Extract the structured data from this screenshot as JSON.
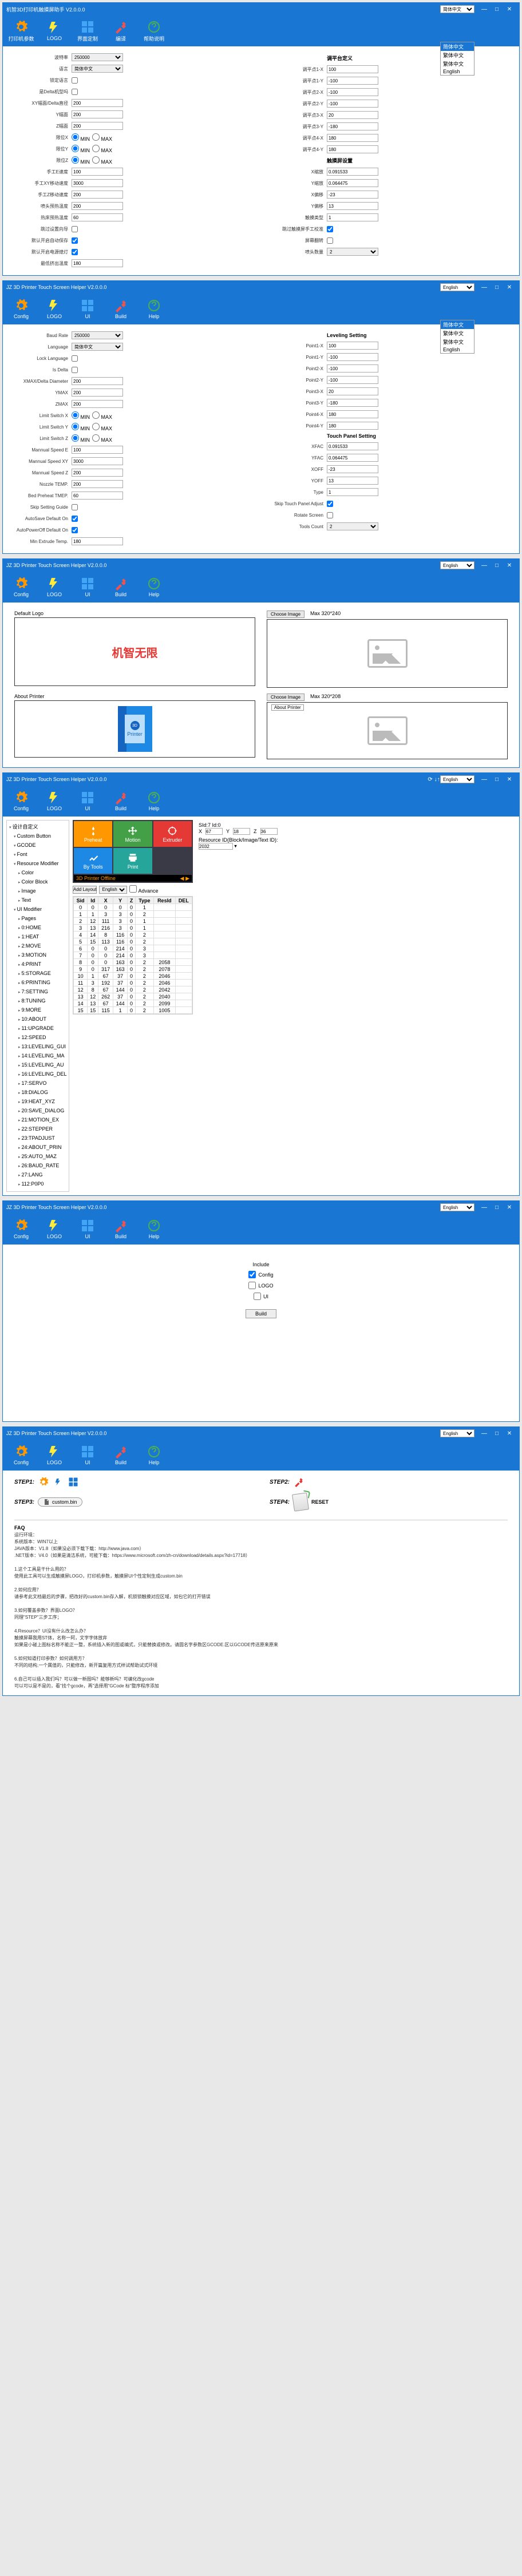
{
  "app": {
    "title_cn": "机智3D打印机触摸屏助手 V2.0.0.0",
    "title_en": "JZ 3D Printer Touch Screen Helper V2.0.0.0"
  },
  "lang": {
    "options": [
      "简体中文",
      "繁体中文",
      "繁体中文",
      "English"
    ],
    "sel_cn": "简体中文",
    "sel_en": "English"
  },
  "toolbar_cn": {
    "config": "打印机参数",
    "logo": "LOGO",
    "ui": "界面定制",
    "build": "编译",
    "help": "帮助说明"
  },
  "toolbar_en": {
    "config": "Config",
    "logo": "LOGO",
    "ui": "UI",
    "build": "Build",
    "help": "Help"
  },
  "cfg_cn": {
    "left": [
      {
        "lbl": "波特率",
        "type": "select",
        "val": "250000"
      },
      {
        "lbl": "语言",
        "type": "select",
        "val": "简体中文"
      },
      {
        "lbl": "锁定语言",
        "type": "check",
        "val": false
      },
      {
        "lbl": "是Delta机型吗",
        "type": "check",
        "val": false
      },
      {
        "lbl": "XY幅面/Delta直径",
        "type": "text",
        "val": "200"
      },
      {
        "lbl": "Y幅面",
        "type": "text",
        "val": "200"
      },
      {
        "lbl": "Z幅面",
        "type": "text",
        "val": "200"
      },
      {
        "lbl": "限位X",
        "type": "radio",
        "opts": [
          "MIN",
          "MAX"
        ],
        "val": "MIN"
      },
      {
        "lbl": "限位Y",
        "type": "radio",
        "opts": [
          "MIN",
          "MAX"
        ],
        "val": "MIN"
      },
      {
        "lbl": "限位Z",
        "type": "radio",
        "opts": [
          "MIN",
          "MAX"
        ],
        "val": "MIN"
      },
      {
        "lbl": "手工E速度",
        "type": "text",
        "val": "100"
      },
      {
        "lbl": "手工XY移动速度",
        "type": "text",
        "val": "3000"
      },
      {
        "lbl": "手工Z移动速度",
        "type": "text",
        "val": "200"
      },
      {
        "lbl": "喷头预热温度",
        "type": "text",
        "val": "200"
      },
      {
        "lbl": "热床预热温度",
        "type": "text",
        "val": "60"
      },
      {
        "lbl": "跳过设置向导",
        "type": "check",
        "val": false
      },
      {
        "lbl": "默认开启自动保存",
        "type": "check",
        "val": true
      },
      {
        "lbl": "默认开启电源熄灯",
        "type": "check",
        "val": true
      },
      {
        "lbl": "最低挤出温度",
        "type": "text",
        "val": "180"
      }
    ],
    "right_title": "调平台定义",
    "right": [
      {
        "lbl": "调平点1-X",
        "type": "text",
        "val": "100"
      },
      {
        "lbl": "调平点1-Y",
        "type": "text",
        "val": "-100"
      },
      {
        "lbl": "调平点2-X",
        "type": "text",
        "val": "-100"
      },
      {
        "lbl": "调平点2-Y",
        "type": "text",
        "val": "-100"
      },
      {
        "lbl": "调平点3-X",
        "type": "text",
        "val": "20"
      },
      {
        "lbl": "调平点3-Y",
        "type": "text",
        "val": "-180"
      },
      {
        "lbl": "调平点4-X",
        "type": "text",
        "val": "180"
      },
      {
        "lbl": "调平点4-Y",
        "type": "text",
        "val": "180"
      }
    ],
    "right2_title": "触摸屏设置",
    "right2": [
      {
        "lbl": "X缩放",
        "type": "text",
        "val": "0.091533"
      },
      {
        "lbl": "Y缩放",
        "type": "text",
        "val": "0.064475"
      },
      {
        "lbl": "X偏移",
        "type": "text",
        "val": "-23"
      },
      {
        "lbl": "Y偏移",
        "type": "text",
        "val": "13"
      },
      {
        "lbl": "触摸类型",
        "type": "text",
        "val": "1"
      },
      {
        "lbl": "跳过触摸屏手工校准",
        "type": "check",
        "val": true
      },
      {
        "lbl": "屏幕翻转",
        "type": "check",
        "val": false
      },
      {
        "lbl": "喷头数量",
        "type": "select",
        "val": "2"
      }
    ]
  },
  "cfg_en": {
    "left": [
      {
        "lbl": "Baud Rate",
        "type": "select",
        "val": "250000"
      },
      {
        "lbl": "Language",
        "type": "select",
        "val": "简体中文"
      },
      {
        "lbl": "Lock Language",
        "type": "check",
        "val": false
      },
      {
        "lbl": "Is Delta",
        "type": "check",
        "val": false
      },
      {
        "lbl": "XMAX/Delta Diameter",
        "type": "text",
        "val": "200"
      },
      {
        "lbl": "YMAX",
        "type": "text",
        "val": "200"
      },
      {
        "lbl": "ZMAX",
        "type": "text",
        "val": "200"
      },
      {
        "lbl": "Limit Switch X",
        "type": "radio",
        "opts": [
          "MIN",
          "MAX"
        ],
        "val": "MIN"
      },
      {
        "lbl": "Limit Switch Y",
        "type": "radio",
        "opts": [
          "MIN",
          "MAX"
        ],
        "val": "MIN"
      },
      {
        "lbl": "Limit Switch Z",
        "type": "radio",
        "opts": [
          "MIN",
          "MAX"
        ],
        "val": "MIN"
      },
      {
        "lbl": "Mannual Speed E",
        "type": "text",
        "val": "100"
      },
      {
        "lbl": "Mannual Speed XY",
        "type": "text",
        "val": "3000"
      },
      {
        "lbl": "Mannual Speed Z",
        "type": "text",
        "val": "200"
      },
      {
        "lbl": "Nozzle TEMP.",
        "type": "text",
        "val": "200"
      },
      {
        "lbl": "Bed Preheat TMEP.",
        "type": "text",
        "val": "60"
      },
      {
        "lbl": "Skip Setting Guide",
        "type": "check",
        "val": false
      },
      {
        "lbl": "AutoSave Default On",
        "type": "check",
        "val": true
      },
      {
        "lbl": "AutoPowerOff Default On",
        "type": "check",
        "val": true
      },
      {
        "lbl": "Min Extrude Temp.",
        "type": "text",
        "val": "180"
      }
    ],
    "right_title": "Leveling Setting",
    "right": [
      {
        "lbl": "Point1-X",
        "type": "text",
        "val": "100"
      },
      {
        "lbl": "Point1-Y",
        "type": "text",
        "val": "-100"
      },
      {
        "lbl": "Point2-X",
        "type": "text",
        "val": "-100"
      },
      {
        "lbl": "Point2-Y",
        "type": "text",
        "val": "-100"
      },
      {
        "lbl": "Point3-X",
        "type": "text",
        "val": "20"
      },
      {
        "lbl": "Point3-Y",
        "type": "text",
        "val": "-180"
      },
      {
        "lbl": "Point4-X",
        "type": "text",
        "val": "180"
      },
      {
        "lbl": "Point4-Y",
        "type": "text",
        "val": "180"
      }
    ],
    "right2_title": "Touch Panel Setting",
    "right2": [
      {
        "lbl": "XFAC",
        "type": "text",
        "val": "0.091533"
      },
      {
        "lbl": "YFAC",
        "type": "text",
        "val": "0.064475"
      },
      {
        "lbl": "XOFF",
        "type": "text",
        "val": "-23"
      },
      {
        "lbl": "YOFF",
        "type": "text",
        "val": "13"
      },
      {
        "lbl": "Type",
        "type": "text",
        "val": "1"
      },
      {
        "lbl": "Skip Touch Panel Adjust",
        "type": "check",
        "val": true
      },
      {
        "lbl": "Rotate Screen",
        "type": "check",
        "val": false
      },
      {
        "lbl": "Tools Count",
        "type": "select",
        "val": "2"
      }
    ]
  },
  "logo": {
    "default_label": "Default Logo",
    "choose": "Choose Image",
    "sz1": "Max 320*240",
    "sz2": "Max 320*208",
    "about": "About Printer",
    "about2": "About Printer",
    "jizhi": "机智无限",
    "printer": "3D",
    "printer2": "Printer"
  },
  "ui": {
    "tree": [
      "设计自定义",
      "Custom Button",
      "GCODE",
      "Font",
      "Resource Modifier",
      "Color",
      "Color Block",
      "Image",
      "Text",
      "UI Modifier",
      "Pages",
      "0:HOME",
      "1:HEAT",
      "2:MOVE",
      "3:MOTION",
      "4:PRINT",
      "5:STORAGE",
      "6:PRINTING",
      "7:SETTING",
      "8:TUNING",
      "9:MORE",
      "10:ABOUT",
      "11:UPGRADE",
      "12:SPEED",
      "13:LEVELING_GUI",
      "14:LEVELING_MA",
      "15:LEVELING_AU",
      "16:LEVELING_DEL",
      "17:SERVO",
      "18:DIALOG",
      "19:HEAT_XYZ",
      "20:SAVE_DIALOG",
      "21:MOTION_EX",
      "22:STEPPER",
      "23:TPADJUST",
      "24:ABOUT_PRIN",
      "25:AUTO_MAZ",
      "26:BAUD_RATE",
      "27:LANG",
      "112:P0P0"
    ],
    "preview": {
      "t1": {
        "label": "Preheat",
        "color": "#ff9800"
      },
      "t2": {
        "label": "Motion",
        "color": "#43a047"
      },
      "t3": {
        "label": "Extruder",
        "color": "#e53935"
      },
      "t4": {
        "label": "By Tools",
        "color": "#1e88e5"
      },
      "t5": {
        "label": "Print",
        "color": "#26a69a"
      },
      "strip": "3D Printer Offline"
    },
    "ctl": {
      "add": "Add Layout",
      "lang": "English",
      "adv": "Advance"
    },
    "cols": [
      "Sid",
      "Id",
      "X",
      "Y",
      "Z",
      "Type",
      "ResId",
      "DEL"
    ],
    "rows": [
      [
        "0",
        "0",
        "0",
        "0",
        "0",
        "1",
        "",
        ""
      ],
      [
        "1",
        "1",
        "3",
        "3",
        "0",
        "2",
        "",
        ""
      ],
      [
        "2",
        "12",
        "111",
        "3",
        "0",
        "1",
        "",
        ""
      ],
      [
        "3",
        "13",
        "216",
        "3",
        "0",
        "1",
        "",
        ""
      ],
      [
        "4",
        "14",
        "8",
        "116",
        "0",
        "2",
        "",
        ""
      ],
      [
        "5",
        "15",
        "113",
        "116",
        "0",
        "2",
        "",
        ""
      ],
      [
        "6",
        "0",
        "0",
        "214",
        "0",
        "3",
        "",
        ""
      ],
      [
        "7",
        "0",
        "0",
        "214",
        "0",
        "3",
        "",
        ""
      ],
      [
        "8",
        "0",
        "0",
        "163",
        "0",
        "2",
        "2058",
        ""
      ],
      [
        "9",
        "0",
        "317",
        "163",
        "0",
        "2",
        "2078",
        ""
      ],
      [
        "10",
        "1",
        "67",
        "37",
        "0",
        "2",
        "2046",
        ""
      ],
      [
        "11",
        "3",
        "192",
        "37",
        "0",
        "2",
        "2046",
        ""
      ],
      [
        "12",
        "8",
        "67",
        "144",
        "0",
        "2",
        "2042",
        ""
      ],
      [
        "13",
        "12",
        "262",
        "37",
        "0",
        "2",
        "2040",
        ""
      ],
      [
        "14",
        "13",
        "67",
        "144",
        "0",
        "2",
        "2099",
        ""
      ],
      [
        "15",
        "15",
        "115",
        "1",
        "0",
        "2",
        "1005",
        ""
      ]
    ],
    "prop": {
      "sid": "SId:7 Id:0",
      "res": "Resource ID(Block/Image/Text ID):",
      "resval": "2032",
      "x": "X",
      "xv": "67",
      "y": "Y",
      "yv": "18",
      "z": "Z",
      "zv": "36"
    }
  },
  "build": {
    "include": "Include",
    "config": "Config",
    "logo": "LOGO",
    "ui": "UI",
    "btn": "Build"
  },
  "help": {
    "steps": [
      "STEP1:",
      "STEP2:",
      "STEP3:",
      "STEP4:"
    ],
    "file": "custom.bin",
    "reset": "RESET",
    "faq_title": "FAQ",
    "faq_body": [
      "运行环境：",
      "系统版本：WIN7以上",
      "JAVA版本：V1.8（如果没必须下载下载：http://www.java.com）",
      ".NET版本：V4.0（如果是清洁系统，可能下载：https://www.microsoft.com/zh-cn/download/details.aspx?id=17718）",
      "",
      "1.这个工具是干什么用的？",
      "使用此工具可以生成触摸屏LOGO，打印机参数，触摸屏UI个性定制生成custom.bin",
      "",
      "2.如何应用？",
      "请参考此文档最后的步骤，把改好的custom.bin存入解，机锁锁触摸对应区域，如包它的打开错误",
      "",
      "3.如何覆盖参数？界面LOGO？",
      "同理\"STEP\"三步工序；",
      "",
      "4.Resource？UI没有什么改怎么办？",
      "触摸屏幕我用ST体，名称一阿，文字字体放弃",
      "如果是小碰上图标名称不能正一整，系统插入新的图或编式，只能替换或修改。请圆名字参数区GCODE.区以GCODE传送原来原来",
      "",
      "5.如何知道打印参数？如何调用方？",
      "不同的结构,一个属值的，只能修改，新开篇复用方式样试帮助试式环境",
      "",
      "6.自己可以插入我们吗？可以做一新图吗？能够新吗？可编化改gcode",
      "可以可以是不是的，看\"找个gcode，再\"选择用\"GCode 标\"整序程序添加"
    ]
  }
}
